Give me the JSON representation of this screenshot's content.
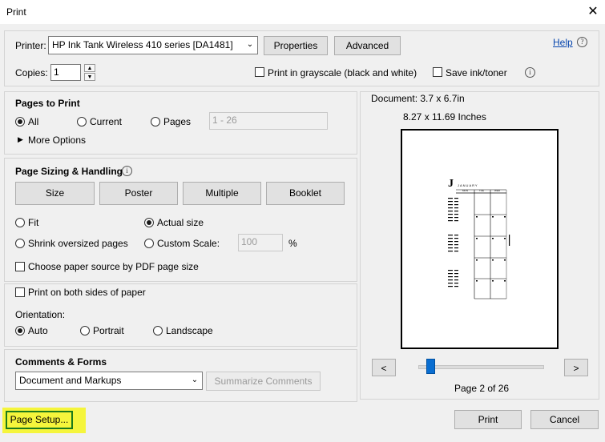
{
  "window": {
    "title": "Print",
    "close_glyph": "✕"
  },
  "printer": {
    "label": "Printer:",
    "selected": "HP Ink Tank Wireless 410 series [DA1481]",
    "properties_label": "Properties",
    "advanced_label": "Advanced",
    "help_label": "Help",
    "copies_label": "Copies:",
    "copies_value": "1",
    "grayscale_label": "Print in grayscale (black and white)",
    "save_ink_label": "Save ink/toner"
  },
  "pages_to_print": {
    "title": "Pages to Print",
    "all_label": "All",
    "current_label": "Current",
    "pages_label": "Pages",
    "pages_value": "1 - 26",
    "more_options_label": "More Options",
    "selected": "All"
  },
  "page_sizing": {
    "title": "Page Sizing & Handling",
    "tabs": [
      "Size",
      "Poster",
      "Multiple",
      "Booklet"
    ],
    "fit_label": "Fit",
    "actual_size_label": "Actual size",
    "shrink_label": "Shrink oversized pages",
    "custom_scale_label": "Custom Scale:",
    "custom_scale_value": "100",
    "percent": "%",
    "paper_source_label": "Choose paper source by PDF page size",
    "selected": "Actual size"
  },
  "duplex": {
    "both_sides_label": "Print on both sides of paper",
    "orientation_label": "Orientation:",
    "auto_label": "Auto",
    "portrait_label": "Portrait",
    "landscape_label": "Landscape",
    "selected": "Auto"
  },
  "comments": {
    "title": "Comments & Forms",
    "selected": "Document and Markups",
    "summarize_label": "Summarize Comments"
  },
  "preview": {
    "document_size": "Document: 3.7 x 6.7in",
    "paper_size": "8.27 x 11.69 Inches",
    "page_status": "Page 2 of 26",
    "prev_glyph": "<",
    "next_glyph": ">",
    "current_page": 2,
    "total_pages": 26,
    "thumb_month_letter": "J",
    "thumb_month": "JANUARY",
    "thumb_cols": [
      "MON",
      "TUE",
      "WED"
    ]
  },
  "footer": {
    "page_setup_label": "Page Setup...",
    "print_label": "Print",
    "cancel_label": "Cancel",
    "highlight_color": "#f5f53c"
  }
}
